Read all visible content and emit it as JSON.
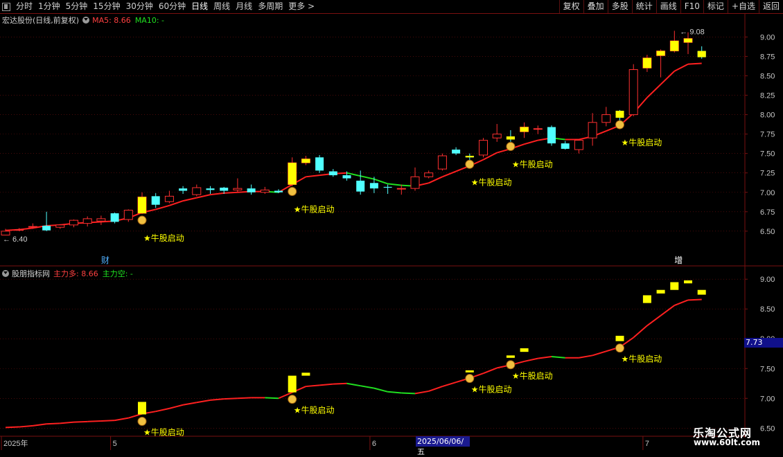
{
  "toolbar": {
    "periods": [
      "分时",
      "1分钟",
      "5分钟",
      "15分钟",
      "30分钟",
      "60分钟",
      "日线",
      "周线",
      "月线",
      "多周期",
      "更多 >"
    ],
    "active_period": "日线",
    "buttons": [
      "复权",
      "叠加",
      "多股",
      "统计",
      "画线",
      "F10",
      "标记",
      "+自选",
      "返回"
    ]
  },
  "main_panel": {
    "stock_name": "宏达股份(日线,前复权)",
    "ma5_label": "MA5: 8.66",
    "ma10_label": "MA10: -",
    "high_marker": "9.08",
    "low_marker": "6.40",
    "price_ticks": [
      "9.00",
      "8.75",
      "8.50",
      "8.25",
      "8.00",
      "7.75",
      "7.50",
      "7.25",
      "7.00",
      "6.75",
      "6.50"
    ],
    "y_range": [
      6.24,
      9.28
    ],
    "bottom_tags": [
      {
        "text": "财",
        "idx": 7
      },
      {
        "text": "增",
        "idx": 49
      }
    ],
    "signal_text": "★牛股启动",
    "signal_positions": [
      10,
      21,
      34,
      37,
      45
    ]
  },
  "indicator_panel": {
    "name": "股朋指标网",
    "main_long_label": "主力多: 8.66",
    "main_short_label": "主力空: -",
    "price_ticks": [
      "9.00",
      "8.50",
      "8.00",
      "7.50",
      "7.00",
      "6.50"
    ],
    "y_range": [
      6.48,
      9.2
    ],
    "current_value": "7.73"
  },
  "date_axis": {
    "labels": [
      {
        "text": "2025年",
        "idx": 0
      },
      {
        "text": "5",
        "idx": 8
      },
      {
        "text": "6",
        "idx": 27
      },
      {
        "text": "7",
        "idx": 47
      }
    ],
    "highlight": "2025/06/06/五"
  },
  "watermark": {
    "title": "乐淘公式网",
    "url": "www.60lt.com"
  },
  "colors": {
    "up": "#ff3030",
    "down": "#50ffff",
    "signal": "#ffff00",
    "ma_up": "#ff2020",
    "ma_down": "#20e020",
    "grid": "#7a1010"
  },
  "chart_data": {
    "type": "candlestick",
    "ohlc": [
      [
        6.45,
        6.5,
        6.48,
        6.53
      ],
      [
        6.52,
        6.52,
        6.5,
        6.54
      ],
      [
        6.56,
        6.56,
        6.53,
        6.6
      ],
      [
        6.57,
        6.51,
        6.5,
        6.75
      ],
      [
        6.55,
        6.58,
        6.53,
        6.59
      ],
      [
        6.58,
        6.64,
        6.55,
        6.65
      ],
      [
        6.6,
        6.66,
        6.56,
        6.69
      ],
      [
        6.63,
        6.66,
        6.58,
        6.7
      ],
      [
        6.73,
        6.62,
        6.6,
        6.74
      ],
      [
        6.65,
        6.77,
        6.62,
        6.78
      ],
      [
        6.73,
        6.94,
        6.72,
        7.0
      ],
      [
        6.95,
        6.84,
        6.8,
        6.99
      ],
      [
        6.88,
        6.95,
        6.86,
        7.02
      ],
      [
        7.05,
        7.02,
        6.98,
        7.08
      ],
      [
        6.97,
        7.06,
        6.95,
        7.1
      ],
      [
        7.05,
        7.03,
        6.98,
        7.08
      ],
      [
        7.06,
        7.02,
        6.98,
        7.07
      ],
      [
        7.03,
        7.05,
        7.0,
        7.18
      ],
      [
        7.05,
        7.0,
        6.97,
        7.1
      ],
      [
        7.0,
        7.03,
        6.98,
        7.07
      ],
      [
        7.02,
        7.0,
        6.99,
        7.04
      ],
      [
        7.1,
        7.38,
        7.08,
        7.45
      ],
      [
        7.38,
        7.43,
        7.35,
        7.47
      ],
      [
        7.45,
        7.28,
        7.25,
        7.48
      ],
      [
        7.27,
        7.22,
        7.2,
        7.3
      ],
      [
        7.22,
        7.18,
        7.15,
        7.27
      ],
      [
        7.15,
        7.01,
        6.97,
        7.28
      ],
      [
        7.12,
        7.05,
        6.99,
        7.2
      ],
      [
        7.07,
        7.06,
        6.98,
        7.1
      ],
      [
        7.05,
        7.05,
        6.97,
        7.1
      ],
      [
        7.05,
        7.2,
        7.02,
        7.32
      ],
      [
        7.2,
        7.25,
        7.18,
        7.28
      ],
      [
        7.3,
        7.47,
        7.28,
        7.5
      ],
      [
        7.55,
        7.5,
        7.48,
        7.58
      ],
      [
        7.47,
        7.45,
        7.4,
        7.5
      ],
      [
        7.48,
        7.67,
        7.45,
        7.7
      ],
      [
        7.7,
        7.75,
        7.65,
        7.88
      ],
      [
        7.72,
        7.68,
        7.65,
        7.8
      ],
      [
        7.78,
        7.84,
        7.7,
        7.9
      ],
      [
        7.82,
        7.82,
        7.75,
        7.86
      ],
      [
        7.84,
        7.63,
        7.6,
        7.86
      ],
      [
        7.63,
        7.56,
        7.55,
        7.66
      ],
      [
        7.55,
        7.67,
        7.5,
        7.68
      ],
      [
        7.7,
        7.9,
        7.6,
        8.02
      ],
      [
        7.9,
        8.0,
        7.85,
        8.1
      ],
      [
        8.05,
        7.96,
        7.9,
        8.06
      ],
      [
        8.0,
        8.58,
        7.98,
        8.65
      ],
      [
        8.6,
        8.73,
        8.55,
        8.77
      ],
      [
        8.76,
        8.82,
        8.48,
        8.84
      ],
      [
        8.82,
        8.95,
        8.8,
        9.08
      ],
      [
        8.93,
        8.98,
        8.78,
        9.06
      ],
      [
        8.82,
        8.74,
        8.72,
        8.88
      ]
    ],
    "ma5": [
      6.51,
      6.52,
      6.54,
      6.57,
      6.58,
      6.6,
      6.61,
      6.62,
      6.63,
      6.67,
      6.74,
      6.78,
      6.83,
      6.89,
      6.93,
      6.97,
      6.99,
      7.0,
      7.01,
      7.01,
      7.0,
      7.1,
      7.2,
      7.22,
      7.24,
      7.25,
      7.21,
      7.17,
      7.11,
      7.09,
      7.08,
      7.12,
      7.2,
      7.27,
      7.34,
      7.42,
      7.51,
      7.56,
      7.62,
      7.67,
      7.7,
      7.68,
      7.68,
      7.72,
      7.79,
      7.86,
      8.02,
      8.22,
      8.39,
      8.56,
      8.65,
      8.66
    ],
    "signals": [
      10,
      21,
      34,
      37,
      45
    ]
  }
}
